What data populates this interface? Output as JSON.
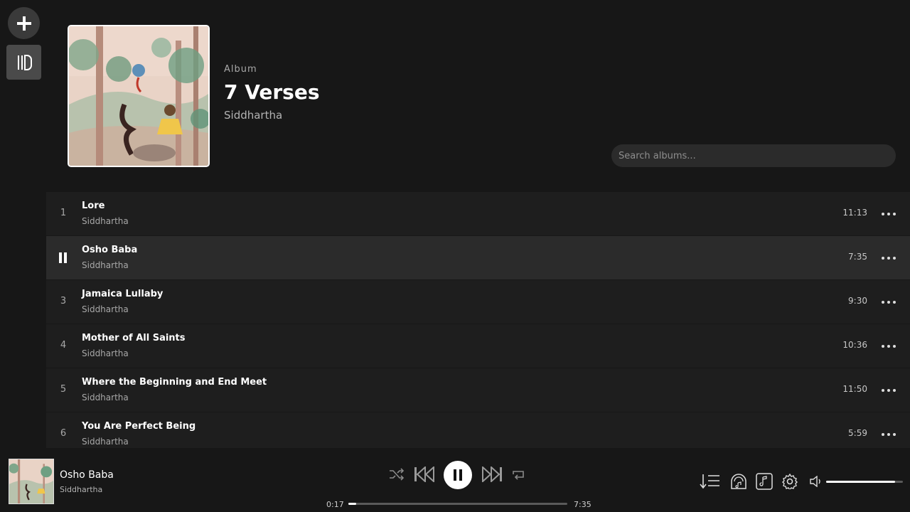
{
  "header": {
    "kind": "Album",
    "title": "7 Verses",
    "artist": "Siddhartha"
  },
  "search": {
    "placeholder": "Search albums..."
  },
  "tracks": [
    {
      "number": "1",
      "title": "Lore",
      "artist": "Siddhartha",
      "duration": "11:13",
      "playing": false
    },
    {
      "number": "2",
      "title": "Osho Baba",
      "artist": "Siddhartha",
      "duration": "7:35",
      "playing": true
    },
    {
      "number": "3",
      "title": "Jamaica Lullaby",
      "artist": "Siddhartha",
      "duration": "9:30",
      "playing": false
    },
    {
      "number": "4",
      "title": "Mother of All Saints",
      "artist": "Siddhartha",
      "duration": "10:36",
      "playing": false
    },
    {
      "number": "5",
      "title": "Where the Beginning and End Meet",
      "artist": "Siddhartha",
      "duration": "11:50",
      "playing": false
    },
    {
      "number": "6",
      "title": "You Are Perfect Being",
      "artist": "Siddhartha",
      "duration": "5:59",
      "playing": false
    }
  ],
  "player": {
    "title": "Osho Baba",
    "artist": "Siddhartha",
    "elapsed": "0:17",
    "total": "7:35",
    "progress_fraction": 0.037,
    "volume_fraction": 0.9
  },
  "colors": {
    "background": "#171717",
    "row": "#1e1e1e",
    "row_active": "#2b2b2b",
    "accent": "#ffffff"
  },
  "icons": {
    "rail": [
      "plus-icon",
      "library-icon"
    ],
    "controls": [
      "shuffle-icon",
      "previous-icon",
      "pause-icon",
      "next-icon",
      "repeat-icon"
    ],
    "right": [
      "queue-icon",
      "radio-icon",
      "lyrics-icon",
      "settings-icon",
      "volume-icon"
    ]
  }
}
